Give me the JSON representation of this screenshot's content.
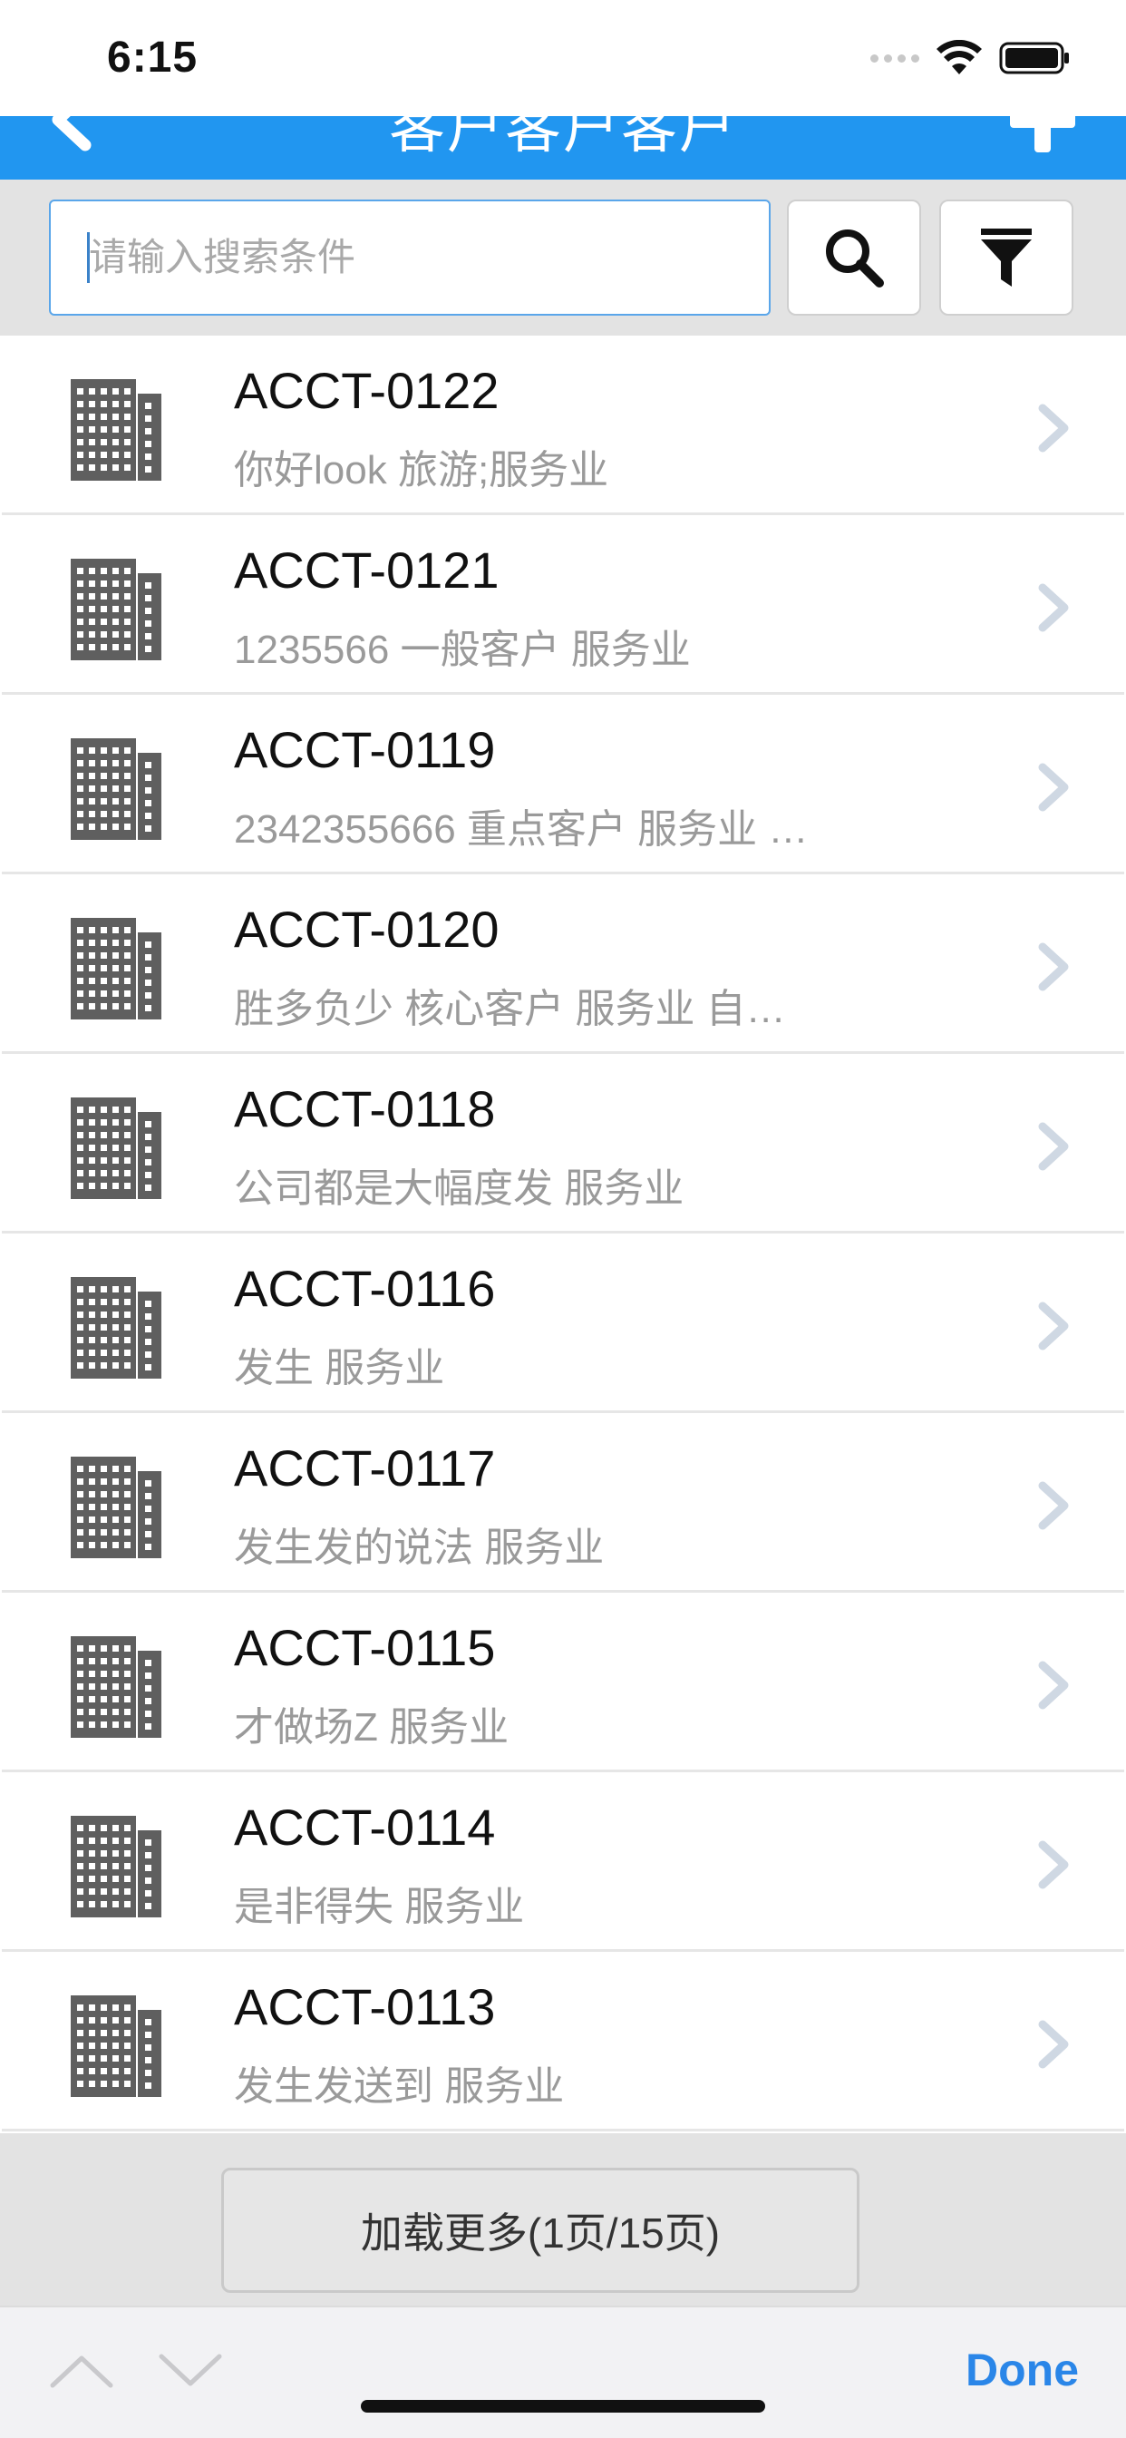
{
  "status_bar": {
    "time": "6:15"
  },
  "nav": {
    "title": "客户客户客户",
    "back_icon": "chevron-left-icon",
    "add_icon": "plus-icon"
  },
  "search": {
    "placeholder": "请输入搜索条件",
    "value": "",
    "search_icon": "search-icon",
    "filter_icon": "filter-icon"
  },
  "accounts": [
    {
      "code": "ACCT-0122",
      "detail": "你好look   旅游;服务业"
    },
    {
      "code": "ACCT-0121",
      "detail": "1235566   一般客户   服务业"
    },
    {
      "code": "ACCT-0119",
      "detail": "2342355666   重点客户   服务业   …"
    },
    {
      "code": "ACCT-0120",
      "detail": "胜多负少   核心客户   服务业   自…"
    },
    {
      "code": "ACCT-0118",
      "detail": "公司都是大幅度发   服务业"
    },
    {
      "code": "ACCT-0116",
      "detail": "发生   服务业"
    },
    {
      "code": "ACCT-0117",
      "detail": "发生发的说法   服务业"
    },
    {
      "code": "ACCT-0115",
      "detail": "才做场Z   服务业"
    },
    {
      "code": "ACCT-0114",
      "detail": "是非得失   服务业"
    },
    {
      "code": "ACCT-0113",
      "detail": "发生发送到   服务业"
    }
  ],
  "load_more": {
    "label": "加载更多(1页/15页)"
  },
  "accessory": {
    "done_label": "Done"
  },
  "colors": {
    "nav_blue": "#2196f0",
    "done_blue": "#2a86e8",
    "icon_gray": "#5f5f5f"
  }
}
